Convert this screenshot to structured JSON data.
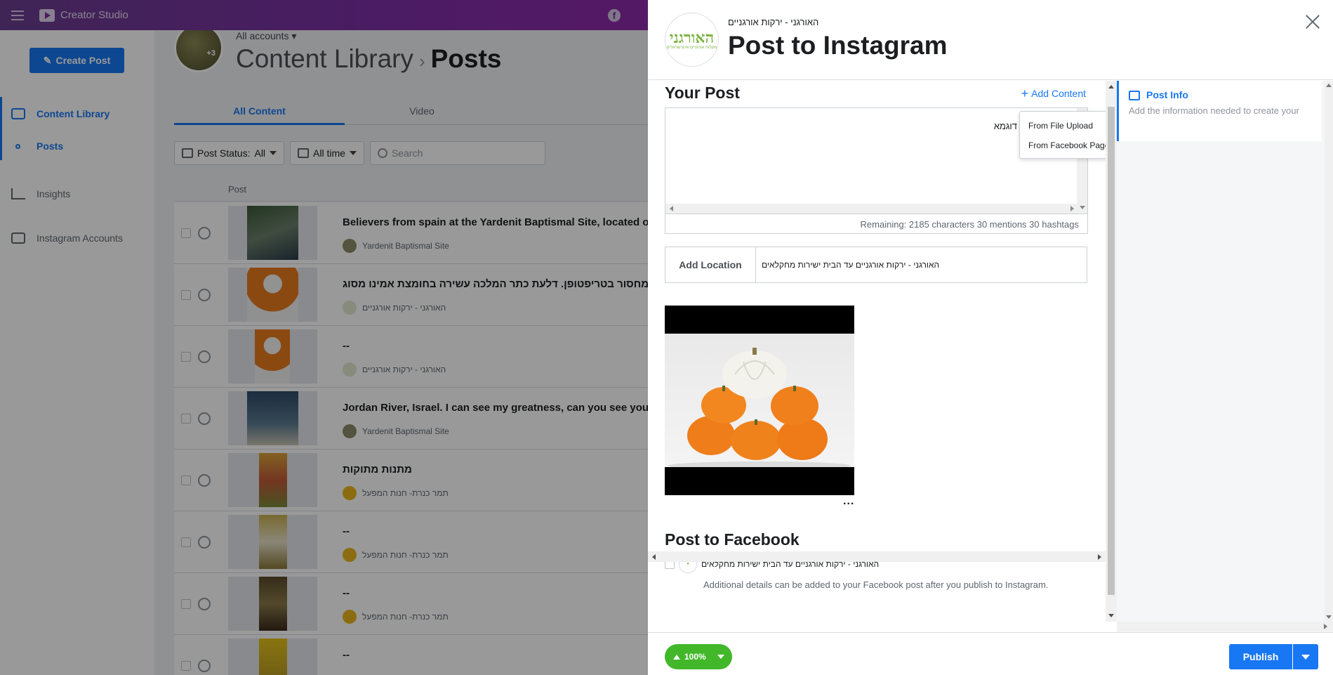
{
  "app": {
    "title": "Creator Studio"
  },
  "sidebar": {
    "create_post": "Create Post",
    "items": [
      {
        "label": "Content Library",
        "active": true
      },
      {
        "label": "Posts",
        "active": true
      },
      {
        "label": "Insights",
        "active": false
      },
      {
        "label": "Instagram Accounts",
        "active": false
      }
    ]
  },
  "header": {
    "account_switch": "All accounts",
    "avatar_badge": "+3",
    "breadcrumb_root": "Content Library",
    "breadcrumb_current": "Posts"
  },
  "tabs": [
    {
      "label": "All Content",
      "active": true
    },
    {
      "label": "Video",
      "active": false
    }
  ],
  "filters": {
    "status_label": "Post Status:",
    "status_value": "All",
    "time_value": "All time",
    "search_placeholder": "Search"
  },
  "list": {
    "column_post": "Post",
    "rows": [
      {
        "text": "Believers from spain at the Yardenit Baptismal Site, located on a pret",
        "account": "Yardenit Baptismal Site",
        "type": "published"
      },
      {
        "text": "יתר תוצאה של מחסור בטריפטופן. דלעת כתר המלכה עשירה בחומצת אמינו מסוג",
        "account": "האורגני - ירקות אורגניים",
        "type": "published"
      },
      {
        "text": "--",
        "account": "האורגני - ירקות אורגניים",
        "type": "scheduled"
      },
      {
        "text": "Jordan River, Israel. I can see my greatness, can you see yours? @m",
        "account": "Yardenit Baptismal Site",
        "type": "published"
      },
      {
        "text": "מתנות מתוקות",
        "account": "תמר כנרת- חנות המפעל",
        "type": "scheduled"
      },
      {
        "text": "--",
        "account": "תמר כנרת- חנות המפעל",
        "type": "scheduled"
      },
      {
        "text": "--",
        "account": "תמר כנרת- חנות המפעל",
        "type": "scheduled"
      },
      {
        "text": "--",
        "account": "",
        "type": "scheduled"
      }
    ]
  },
  "modal": {
    "account_name": "האורגני - ירקות אורגניים",
    "title": "Post to Instagram",
    "logo_text": "האורגני",
    "logo_sub": "מקלות אורגניים ארצישראלים",
    "your_post": "Your Post",
    "add_content": "Add Content",
    "caption": "דוגמא",
    "remaining": "Remaining: 2185 characters 30 mentions 30 hashtags",
    "dropdown": [
      "From File Upload",
      "From Facebook Page"
    ],
    "add_location": "Add Location",
    "location_value": "האורגני - ירקות אורגניים עד הבית ישירות מחקלאים",
    "more": "...",
    "post_to_facebook": "Post to Facebook",
    "fb_page": "האורגני - ירקות אורגניים עד הבית ישירות מחקלאים",
    "fb_note": "Additional details can be added to your Facebook post after you publish to Instagram.",
    "post_info_title": "Post Info",
    "post_info_desc": "Add the information needed to create your",
    "upload_progress": "100%",
    "publish": "Publish"
  },
  "colors": {
    "brand_blue": "#1877f2",
    "header_purple": "#7d2fa6",
    "progress_green": "#42b72a"
  }
}
